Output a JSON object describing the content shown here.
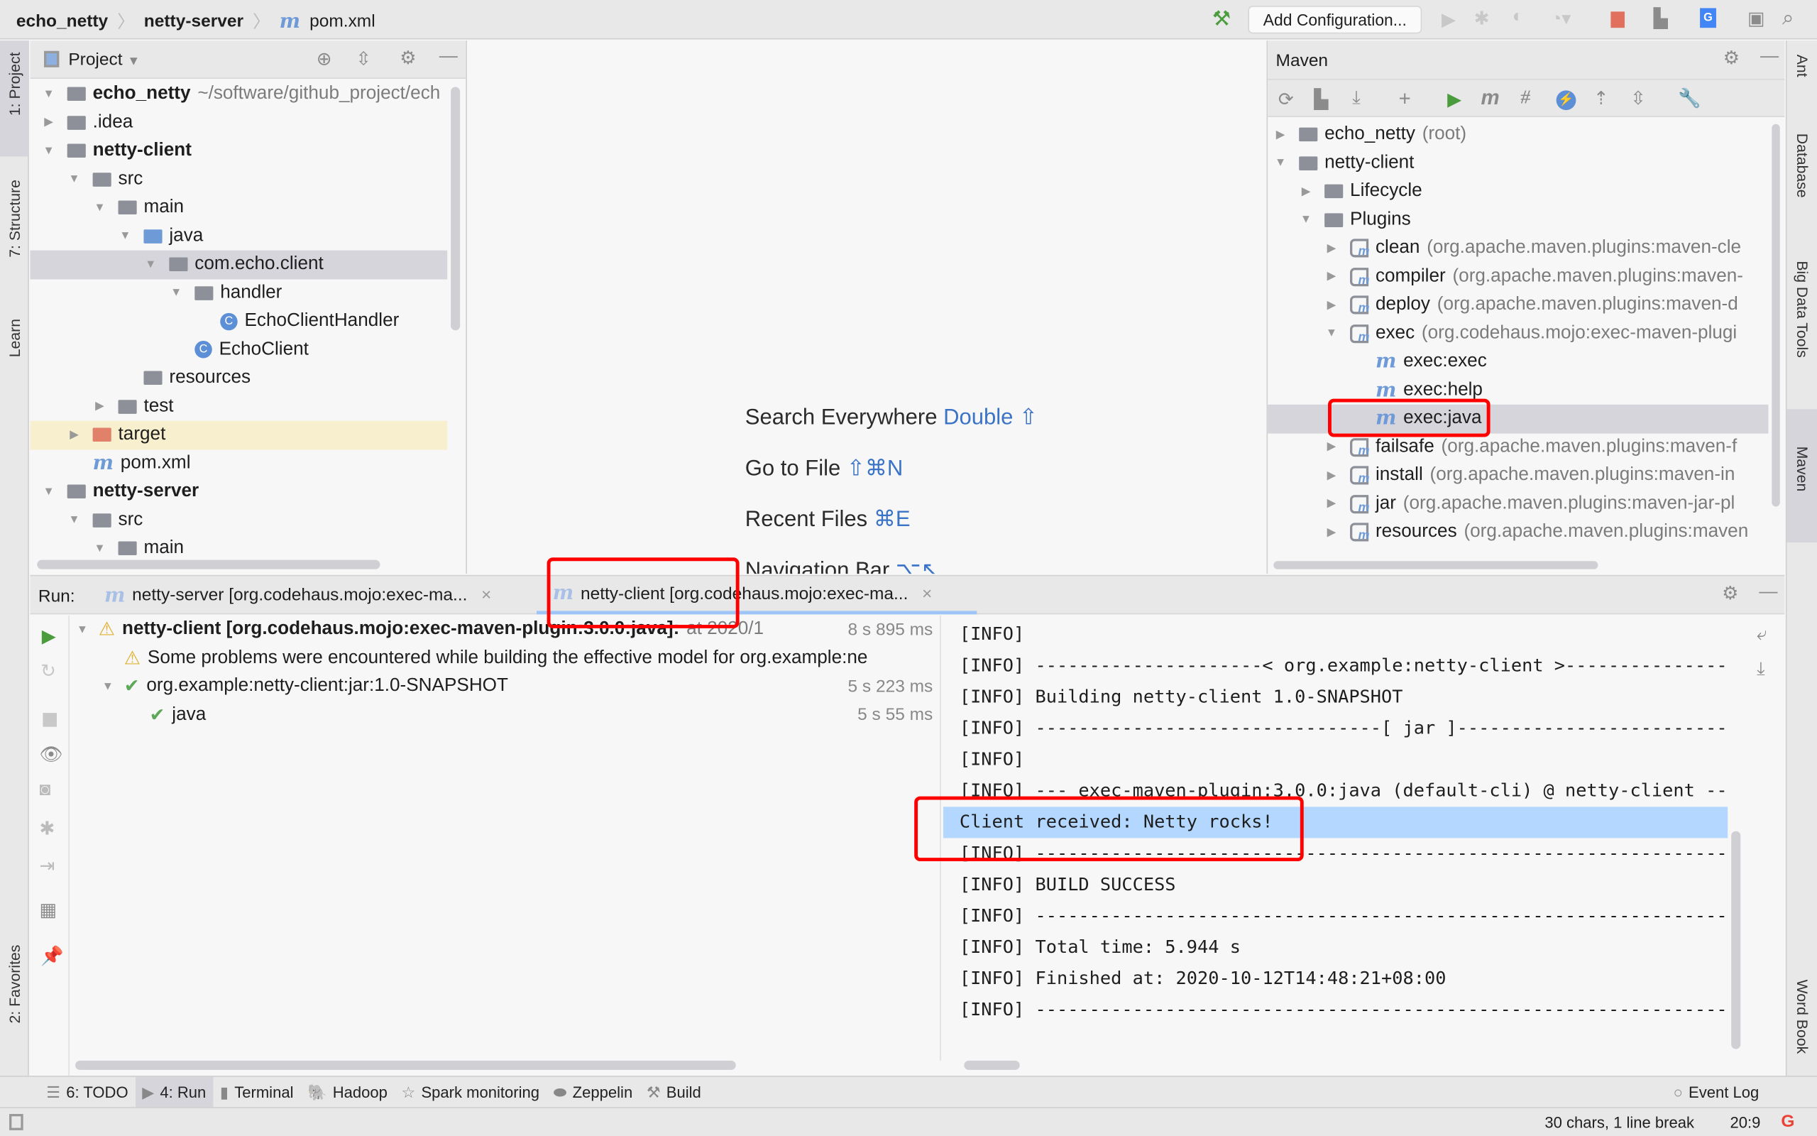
{
  "navbar": {
    "breadcrumb": [
      "echo_netty",
      "netty-server",
      "pom.xml"
    ],
    "add_configuration": "Add Configuration..."
  },
  "left_strip": [
    "1: Project",
    "7: Structure",
    "Learn",
    "2: Favorites"
  ],
  "right_strip": [
    "Ant",
    "Database",
    "Big Data Tools",
    "Maven",
    "Word Book"
  ],
  "project": {
    "title": "Project",
    "tree": [
      {
        "level": 0,
        "arrow": "down",
        "icon": "module",
        "label": "echo_netty",
        "bold": true,
        "secondary": "~/software/github_project/ech"
      },
      {
        "level": 0,
        "arrow": "right",
        "icon": "folder",
        "label": ".idea"
      },
      {
        "level": 0,
        "arrow": "down",
        "icon": "module",
        "label": "netty-client",
        "bold": true
      },
      {
        "level": 1,
        "arrow": "down",
        "icon": "folder",
        "label": "src"
      },
      {
        "level": 2,
        "arrow": "down",
        "icon": "folder",
        "label": "main"
      },
      {
        "level": 3,
        "arrow": "down",
        "icon": "folder-blue",
        "label": "java"
      },
      {
        "level": 4,
        "arrow": "down",
        "icon": "package",
        "label": "com.echo.client",
        "selected": true
      },
      {
        "level": 5,
        "arrow": "down",
        "icon": "package",
        "label": "handler"
      },
      {
        "level": 6,
        "arrow": "",
        "icon": "class",
        "label": "EchoClientHandler"
      },
      {
        "level": 5,
        "arrow": "",
        "icon": "class",
        "label": "EchoClient"
      },
      {
        "level": 3,
        "arrow": "",
        "icon": "folder",
        "label": "resources"
      },
      {
        "level": 2,
        "arrow": "right",
        "icon": "folder",
        "label": "test"
      },
      {
        "level": 1,
        "arrow": "right",
        "icon": "folder-orange",
        "label": "target",
        "excluded": true
      },
      {
        "level": 1,
        "arrow": "",
        "icon": "maven",
        "label": "pom.xml"
      },
      {
        "level": 0,
        "arrow": "down",
        "icon": "module",
        "label": "netty-server",
        "bold": true
      },
      {
        "level": 1,
        "arrow": "down",
        "icon": "folder",
        "label": "src"
      },
      {
        "level": 2,
        "arrow": "down",
        "icon": "folder",
        "label": "main"
      }
    ]
  },
  "editor": {
    "hints": [
      {
        "label": "Search Everywhere",
        "shortcut": "Double ⇧"
      },
      {
        "label": "Go to File",
        "shortcut": "⇧⌘N"
      },
      {
        "label": "Recent Files",
        "shortcut": "⌘E"
      },
      {
        "label": "Navigation Bar",
        "shortcut": "⌥↖"
      }
    ]
  },
  "maven": {
    "title": "Maven",
    "tree": [
      {
        "level": 0,
        "arrow": "right",
        "icon": "maven-module",
        "label": "echo_netty",
        "secondary": "(root)"
      },
      {
        "level": 0,
        "arrow": "down",
        "icon": "maven-module",
        "label": "netty-client"
      },
      {
        "level": 1,
        "arrow": "right",
        "icon": "config-folder",
        "label": "Lifecycle"
      },
      {
        "level": 1,
        "arrow": "down",
        "icon": "config-folder",
        "label": "Plugins"
      },
      {
        "level": 2,
        "arrow": "right",
        "icon": "plugin",
        "label": "clean",
        "secondary": "(org.apache.maven.plugins:maven-cle"
      },
      {
        "level": 2,
        "arrow": "right",
        "icon": "plugin",
        "label": "compiler",
        "secondary": "(org.apache.maven.plugins:maven-"
      },
      {
        "level": 2,
        "arrow": "right",
        "icon": "plugin",
        "label": "deploy",
        "secondary": "(org.apache.maven.plugins:maven-d"
      },
      {
        "level": 2,
        "arrow": "down",
        "icon": "plugin",
        "label": "exec",
        "secondary": "(org.codehaus.mojo:exec-maven-plugi"
      },
      {
        "level": 3,
        "arrow": "",
        "icon": "goal",
        "label": "exec:exec"
      },
      {
        "level": 3,
        "arrow": "",
        "icon": "goal",
        "label": "exec:help"
      },
      {
        "level": 3,
        "arrow": "",
        "icon": "goal",
        "label": "exec:java",
        "selected": true
      },
      {
        "level": 2,
        "arrow": "right",
        "icon": "plugin",
        "label": "failsafe",
        "secondary": "(org.apache.maven.plugins:maven-f"
      },
      {
        "level": 2,
        "arrow": "right",
        "icon": "plugin",
        "label": "install",
        "secondary": "(org.apache.maven.plugins:maven-in"
      },
      {
        "level": 2,
        "arrow": "right",
        "icon": "plugin",
        "label": "jar",
        "secondary": "(org.apache.maven.plugins:maven-jar-pl"
      },
      {
        "level": 2,
        "arrow": "right",
        "icon": "plugin",
        "label": "resources",
        "secondary": "(org.apache.maven.plugins:maven"
      }
    ]
  },
  "run": {
    "label": "Run:",
    "tabs": [
      {
        "label": "netty-server [org.codehaus.mojo:exec-ma...",
        "active": false
      },
      {
        "label": "netty-client [org.codehaus.mojo:exec-ma...",
        "active": true
      }
    ],
    "tree": [
      {
        "level": 0,
        "icon": "warning",
        "label": "netty-client [org.codehaus.mojo:exec-maven-plugin:3.0.0:java]:",
        "suffix": "at 2020/1",
        "time": "8 s 895 ms"
      },
      {
        "level": 1,
        "icon": "warning",
        "label": "Some problems were encountered while building the effective model for org.example:ne",
        "time": ""
      },
      {
        "level": 1,
        "icon": "check",
        "label": "org.example:netty-client:jar:1.0-SNAPSHOT",
        "time": "5 s 223 ms"
      },
      {
        "level": 2,
        "icon": "check",
        "label": "java",
        "time": "5 s 55 ms"
      }
    ],
    "console": [
      "[INFO]",
      "[INFO] ---------------------< org.example:netty-client >----------------------",
      "[INFO] Building netty-client 1.0-SNAPSHOT",
      "[INFO] --------------------------------[ jar ]---------------------------------",
      "[INFO]",
      "[INFO] --- exec-maven-plugin:3.0.0:java (default-cli) @ netty-client ---",
      "Client received: Netty rocks!",
      "[INFO] ------------------------------------------------------------------------",
      "[INFO] BUILD SUCCESS",
      "[INFO] ------------------------------------------------------------------------",
      "[INFO] Total time:  5.944 s",
      "[INFO] Finished at: 2020-10-12T14:48:21+08:00",
      "[INFO] ------------------------------------------------------------------------"
    ],
    "highlighted_line": 6
  },
  "bottom_tools": [
    "6: TODO",
    "4: Run",
    "Terminal",
    "Hadoop",
    "Spark monitoring",
    "Zeppelin",
    "Build"
  ],
  "event_log": "Event Log",
  "status": {
    "selection": "30 chars, 1 line break",
    "position": "20:9"
  },
  "colors": {
    "accent": "#3b73c7",
    "highlight": "#b3d7ff",
    "annotation": "#ff0000",
    "run_green": "#4a9c3c",
    "stop_red": "#e2705f"
  }
}
